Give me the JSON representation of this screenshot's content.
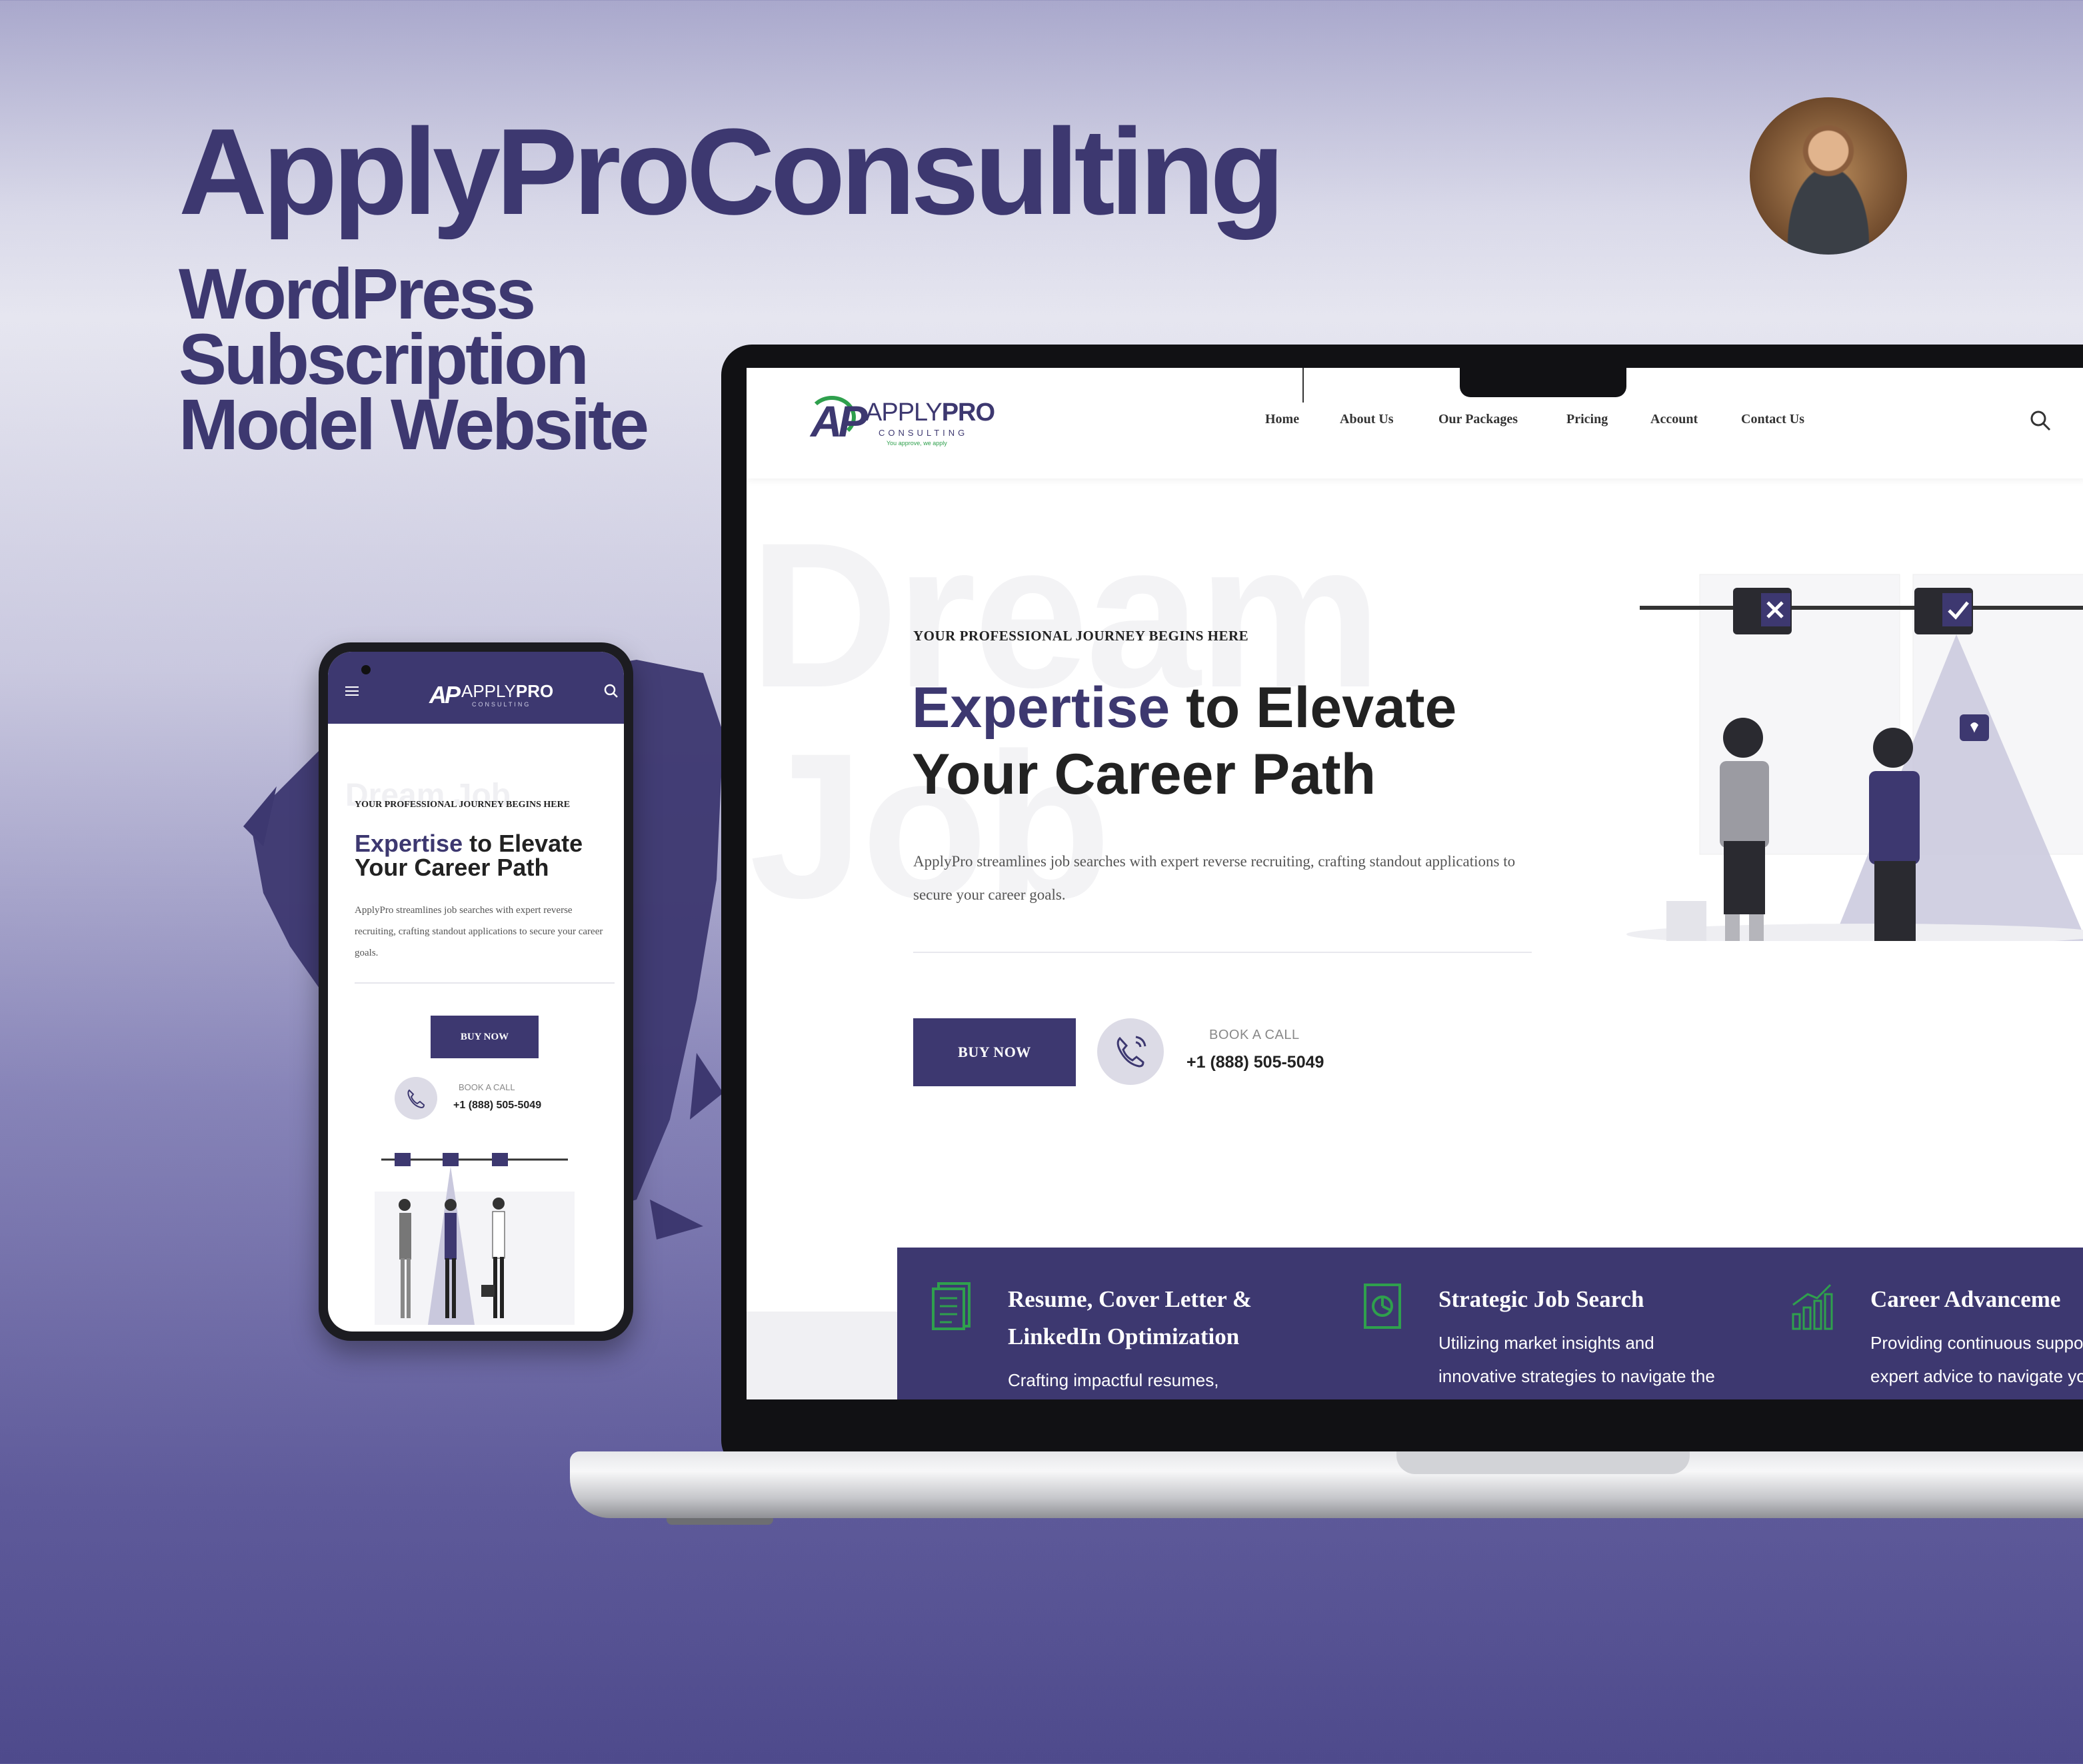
{
  "showcase": {
    "title": "ApplyProConsulting",
    "subtitle_lines": [
      "WordPress",
      "Subscription",
      "Model Website"
    ]
  },
  "colors": {
    "brand": "#3d3870",
    "accent_green": "#2fa04d",
    "background_top": "#e6e6f0",
    "background_bottom": "#4e4a8c"
  },
  "brand": {
    "logo_mark": "AP",
    "logo_prefix": "APPLY",
    "logo_suffix": "PRO",
    "logo_sub": "CONSULTING",
    "logo_tagline": "You approve, we apply"
  },
  "nav": {
    "items": [
      "Home",
      "About Us",
      "Our Packages",
      "Pricing",
      "Account",
      "Contact Us"
    ],
    "search_icon": "search-icon",
    "menu_icon": "hamburger-menu-icon"
  },
  "hero": {
    "ghost_line1": "Dream",
    "ghost_line2": "Job",
    "eyebrow": "YOUR PROFESSIONAL JOURNEY BEGINS HERE",
    "headline_highlight": "Expertise",
    "headline_rest1": " to Elevate",
    "headline_rest2": "Your Career Path",
    "body": "ApplyPro streamlines job searches with expert reverse recruiting, crafting standout applications to secure your career goals.",
    "buy_label": "BUY NOW",
    "book_label": "BOOK A CALL",
    "phone_number": "+1 (888) 505-5049",
    "phone_icon": "phone-icon"
  },
  "services": [
    {
      "icon": "document-list-icon",
      "title_line1": "Resume, Cover Letter &",
      "title_line2": "LinkedIn Optimization",
      "desc_line1": "Crafting impactful resumes,",
      "desc_line2": ""
    },
    {
      "icon": "chart-report-icon",
      "title_line1": "Strategic Job Search",
      "title_line2": "",
      "desc_line1": "Utilizing market insights and",
      "desc_line2": "innovative strategies to navigate the"
    },
    {
      "icon": "growth-chart-icon",
      "title_line1": "Career Advanceme",
      "title_line2": "",
      "desc_line1": "Providing continuous suppo",
      "desc_line2": "expert advice to navigate yo"
    }
  ]
}
